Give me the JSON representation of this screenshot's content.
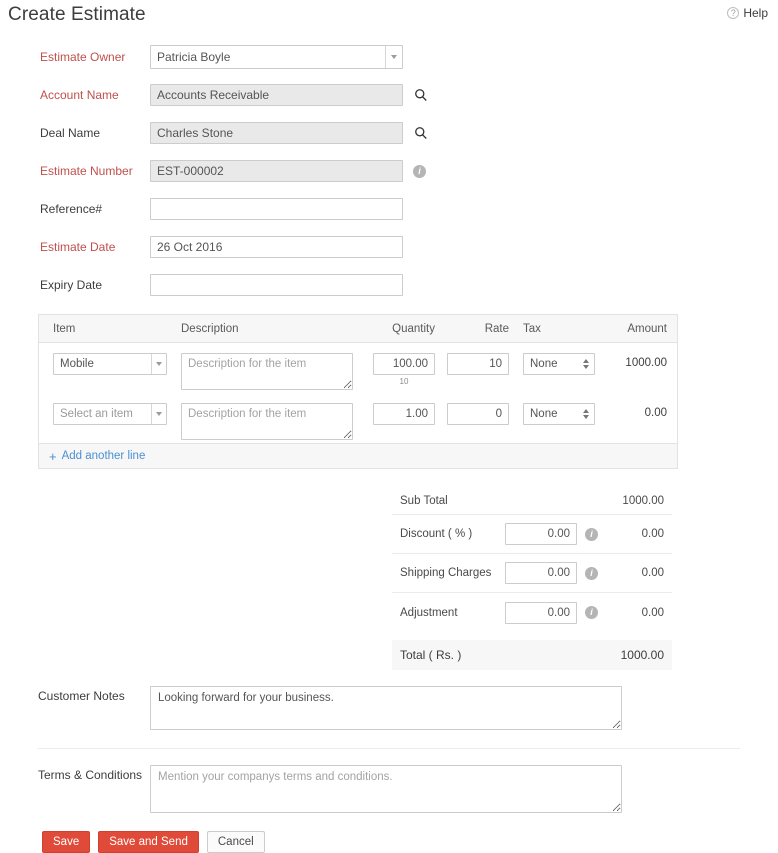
{
  "header": {
    "title": "Create Estimate",
    "help_label": "Help",
    "help_icon": "question-circle-icon"
  },
  "form": {
    "fields": [
      {
        "label": "Estimate Owner",
        "required": true,
        "value": "Patricia Boyle",
        "control": "select"
      },
      {
        "label": "Account Name",
        "required": true,
        "value": "Accounts Receivable",
        "control": "lookup"
      },
      {
        "label": "Deal Name",
        "required": false,
        "value": "Charles Stone",
        "control": "lookup"
      },
      {
        "label": "Estimate Number",
        "required": true,
        "value": "EST-000002",
        "control": "info"
      },
      {
        "label": "Reference#",
        "required": false,
        "value": "",
        "control": "text"
      },
      {
        "label": "Estimate Date",
        "required": true,
        "value": "26 Oct 2016",
        "control": "text"
      },
      {
        "label": "Expiry Date",
        "required": false,
        "value": "",
        "control": "text"
      }
    ]
  },
  "items_table": {
    "columns": [
      "Item",
      "Description",
      "Quantity",
      "Rate",
      "Tax",
      "Amount"
    ],
    "description_placeholder": "Description for the item",
    "item_placeholder": "Select an item",
    "rows": [
      {
        "item": "Mobile",
        "item_is_placeholder": false,
        "description": "",
        "quantity": "100.00",
        "quantity_sub": "10",
        "rate": "10",
        "tax": "None",
        "amount": "1000.00"
      },
      {
        "item": "Select an item",
        "item_is_placeholder": true,
        "description": "",
        "quantity": "1.00",
        "quantity_sub": "",
        "rate": "0",
        "tax": "None",
        "amount": "0.00"
      }
    ],
    "add_line_label": "Add another line"
  },
  "totals": {
    "sub_total_label": "Sub Total",
    "sub_total_value": "1000.00",
    "rows": [
      {
        "label": "Discount ( % )",
        "input": "0.00",
        "value": "0.00"
      },
      {
        "label": "Shipping Charges",
        "input": "0.00",
        "value": "0.00"
      },
      {
        "label": "Adjustment",
        "input": "0.00",
        "value": "0.00"
      }
    ],
    "total_label": "Total ( Rs. )",
    "total_value": "1000.00"
  },
  "notes": {
    "customer_notes_label": "Customer Notes",
    "customer_notes_value": "Looking forward for your business.",
    "terms_label": "Terms & Conditions",
    "terms_value": "",
    "terms_placeholder": "Mention your companys terms and conditions."
  },
  "buttons": {
    "save": "Save",
    "save_and_send": "Save and Send",
    "cancel": "Cancel"
  },
  "colors": {
    "required_label": "#c0504d",
    "primary_button": "#e04b39",
    "link": "#4a8fd2"
  }
}
